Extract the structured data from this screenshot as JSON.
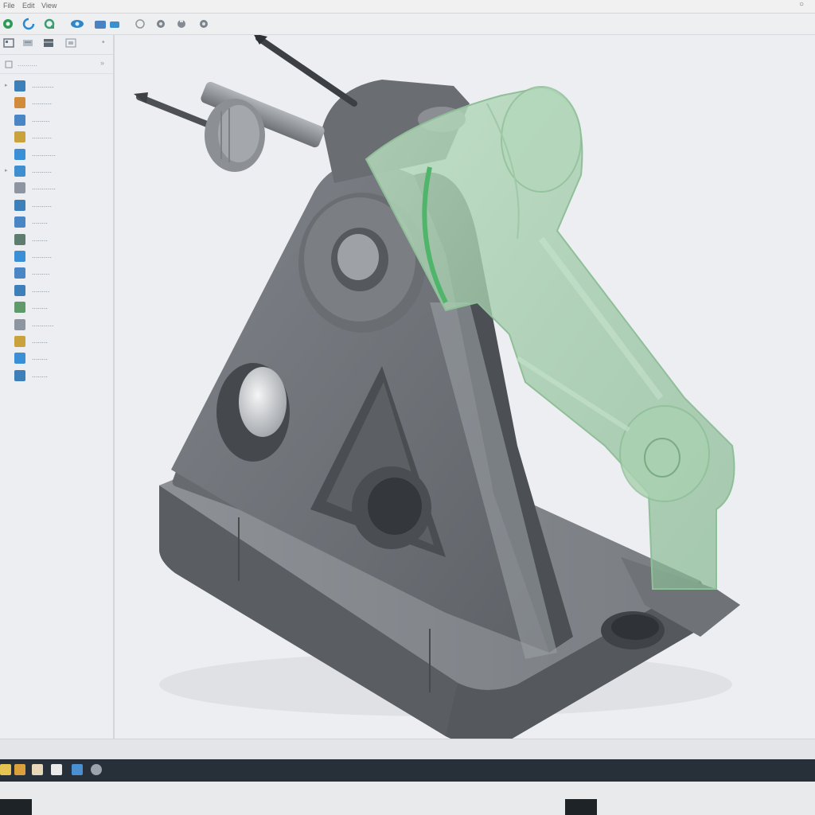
{
  "menu": {
    "items": [
      "File",
      "Edit",
      "View"
    ]
  },
  "toolbar": {
    "buttons": [
      {
        "name": "new-icon",
        "color": "#2f9a58"
      },
      {
        "name": "refresh-icon",
        "color": "#2a8ad0"
      },
      {
        "name": "open-icon",
        "color": "#3b9b73"
      },
      {
        "name": "view-icon",
        "color": "#2f86c8"
      },
      {
        "name": "folder-icon",
        "color": "#4a83c2"
      },
      {
        "name": "layers-icon",
        "color": "#3a8fcf"
      },
      {
        "name": "sketch-icon",
        "color": "#8f969e"
      },
      {
        "name": "extrude-icon",
        "color": "#7b838c"
      },
      {
        "name": "revolve-icon",
        "color": "#848b93"
      },
      {
        "name": "settings-icon",
        "color": "#7b838c"
      }
    ]
  },
  "sidebar": {
    "tabs": [
      "feature-tree-tab",
      "property-tab",
      "config-tab",
      "display-tab"
    ],
    "items": [
      {
        "label": "...........",
        "icon": "assembly-icon",
        "color": "#3d7fb8",
        "expander": "▸"
      },
      {
        "label": "..........",
        "icon": "part-icon",
        "color": "#d08c3a",
        "expander": ""
      },
      {
        "label": ".........",
        "icon": "plane-icon",
        "color": "#4a86c5",
        "expander": ""
      },
      {
        "label": "..........",
        "icon": "sketch-icon",
        "color": "#c9a23b",
        "expander": ""
      },
      {
        "label": "............",
        "icon": "extrude-icon",
        "color": "#3b8fd4",
        "expander": ""
      },
      {
        "label": "..........",
        "icon": "boss-icon",
        "color": "#3f8ed0",
        "expander": "▸"
      },
      {
        "label": "............",
        "icon": "cut-icon",
        "color": "#8d96a0",
        "expander": ""
      },
      {
        "label": "..........",
        "icon": "fillet-icon",
        "color": "#3d7fb8",
        "expander": ""
      },
      {
        "label": "........",
        "icon": "hole-icon",
        "color": "#4a86c5",
        "expander": ""
      },
      {
        "label": "........",
        "icon": "chamfer-icon",
        "color": "#5f7d6e",
        "expander": ""
      },
      {
        "label": "..........",
        "icon": "rib-icon",
        "color": "#3b8fd4",
        "expander": ""
      },
      {
        "label": ".........",
        "icon": "mirror-icon",
        "color": "#4a86c5",
        "expander": ""
      },
      {
        "label": ".........",
        "icon": "pattern-icon",
        "color": "#3d7fb8",
        "expander": ""
      },
      {
        "label": "........",
        "icon": "shell-icon",
        "color": "#5e9a6a",
        "expander": ""
      },
      {
        "label": "...........",
        "icon": "mate-icon",
        "color": "#8d96a0",
        "expander": ""
      },
      {
        "label": "........",
        "icon": "material-icon",
        "color": "#c9a23b",
        "expander": ""
      },
      {
        "label": "........",
        "icon": "body-icon",
        "color": "#3b8fd4",
        "expander": ""
      },
      {
        "label": "........",
        "icon": "origin-icon",
        "color": "#3d7fb8",
        "expander": ""
      }
    ]
  },
  "taskbar": {
    "icons": [
      {
        "name": "start-icon",
        "color": "#f0c040"
      },
      {
        "name": "explorer-icon",
        "color": "#e0a030"
      },
      {
        "name": "notes-icon",
        "color": "#e8e8e8"
      },
      {
        "name": "cad-app-icon",
        "color": "#4a90d0"
      },
      {
        "name": "browser-icon",
        "color": "#9ca3aa"
      }
    ]
  },
  "colors": {
    "part_gray": "#6a6e73",
    "transparent_green": "#9ccaa4",
    "accent_green": "#4fb56a",
    "viewport_bg": "#eceef1"
  }
}
